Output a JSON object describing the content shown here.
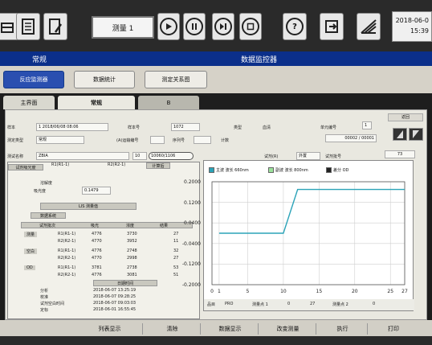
{
  "toolbar": {
    "screen_name": "测量 1",
    "date": "2018-06-0",
    "time": "15:39"
  },
  "title_bar": {
    "left": "常规",
    "right": "数据监控器"
  },
  "nav": {
    "buttons": [
      "反应监测器",
      "数据统计",
      "测定关系图"
    ]
  },
  "tabs": [
    "主界面",
    "常规",
    "B"
  ],
  "info": {
    "sample_label": "样本",
    "sample_value": "1 2018/06/08 08:06",
    "sample_no_label": "样本号",
    "sample_no_value": "1072",
    "type_label": "类型",
    "type_value": "血清",
    "cup_label": "单元编号",
    "cup_value": "1",
    "return_label": "返回",
    "method_label": "测定类型",
    "method_value": "常规",
    "serial_label": "(A)运输编号",
    "series_label": "序列号",
    "count_label": "计数",
    "count_value": "00002 / 00001",
    "test_label": "测试名称",
    "test_value": "ZBIA",
    "test_no": "10",
    "range_value": "10060/1106",
    "reagent_label": "试剂(R)",
    "reagent_value": "外置",
    "lot_label": "试剂批号",
    "lot_value": "73"
  },
  "left_panel": {
    "header": [
      "R1(R1-1)",
      "R2(R2-1)"
    ],
    "row_header": "溶解度",
    "calc_label": "计算后",
    "r1_label": "试剂吸光度",
    "abs_label": "吸光度",
    "abs_value": "0.1479",
    "lis_title": "LIS 测量值",
    "lis_sub": "数据系统",
    "table_headers": [
      "试剂批次",
      "吸光",
      "浓度",
      "结果"
    ],
    "rows": [
      {
        "group": "测量",
        "label": "R1(R1-1)",
        "v1": "4776",
        "v2": "3730",
        "v3": "27"
      },
      {
        "group": "",
        "label": "R2(R2-1)",
        "v1": "4770",
        "v2": "3952",
        "v3": "11"
      },
      {
        "group": "空白",
        "label": "R1(R1-1)",
        "v1": "4776",
        "v2": "2748",
        "v3": "32"
      },
      {
        "group": "",
        "label": "R2(R2-1)",
        "v1": "4770",
        "v2": "2998",
        "v3": "27"
      },
      {
        "group": "OD",
        "label": "R1(R1-1)",
        "v1": "3781",
        "v2": "2738",
        "v3": "53"
      },
      {
        "group": "",
        "label": "R2(R2-1)",
        "v1": "4776",
        "v2": "3081",
        "v3": "51"
      }
    ],
    "time_title": "日期时间",
    "times": [
      {
        "label": "分析",
        "value": "2018-06-07 13:25:19"
      },
      {
        "label": "校准",
        "value": "2018-06-07 09:28:25"
      },
      {
        "label": "试剂空白时间",
        "value": "2018-06-07 09:03:03"
      },
      {
        "label": "定标",
        "value": "2018-06-01 16:55:45"
      }
    ]
  },
  "chart_panel": {
    "legend": [
      {
        "label": "主波 波长 660nm",
        "color": "#2ba3b8"
      },
      {
        "label": "副波 波长 800nm",
        "color": "#9be29b"
      },
      {
        "label": "差分 OD",
        "color": "#222222"
      }
    ],
    "footer_items": [
      "品目",
      "PRO",
      "测量点 1",
      "0",
      "27",
      "测量点 2",
      "0"
    ]
  },
  "chart_data": {
    "type": "line",
    "x_ticks": [
      "0",
      "1",
      "5",
      "10",
      "15",
      "20",
      "25",
      "27"
    ],
    "y_ticks": [
      "0.2000",
      "0.1200",
      "0.0400",
      "-0.0400",
      "-0.1200",
      "-0.2000"
    ],
    "xlim": [
      0,
      27
    ],
    "ylim": [
      -0.2,
      0.2
    ],
    "grid": true,
    "series": [
      {
        "name": "主波 波长 660nm",
        "x": [
          1,
          5,
          10,
          12,
          15,
          20,
          25,
          27
        ],
        "y": [
          0.0,
          0.0,
          0.0,
          0.17,
          0.17,
          0.17,
          0.17,
          0.17
        ]
      }
    ]
  },
  "bottom": {
    "buttons": [
      "列表显示",
      "清除",
      "数据显示",
      "改变测量",
      "执行",
      "打印"
    ]
  }
}
